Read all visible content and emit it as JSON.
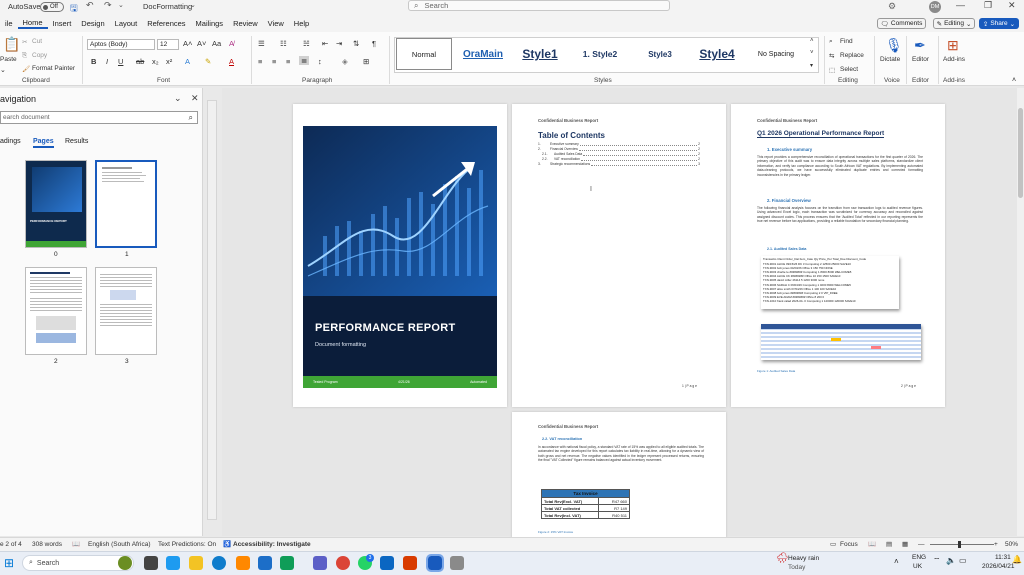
{
  "titlebar": {
    "autosave_label": "AutoSave",
    "autosave_state": "Off",
    "doc_name": "DocFormatting",
    "search_placeholder": "Search",
    "user_initials": "DM"
  },
  "menu": [
    "ile",
    "Home",
    "Insert",
    "Design",
    "Layout",
    "References",
    "Mailings",
    "Review",
    "View",
    "Help"
  ],
  "menu_active": "Home",
  "ribbon": {
    "comments": "Comments",
    "editing": "Editing",
    "share": "Share",
    "clipboard": {
      "paste": "Paste",
      "cut": "Cut",
      "copy": "Copy",
      "format_painter": "Format Painter",
      "group": "Clipboard"
    },
    "font": {
      "name": "Aptos (Body)",
      "size": "12",
      "group": "Font"
    },
    "paragraph_group": "Paragraph",
    "styles": [
      "Normal",
      "OraMain",
      "Style1",
      "1.  Style2",
      "Style3",
      "Style4",
      "No Spacing"
    ],
    "styles_group": "Styles",
    "editing_group": {
      "find": "Find",
      "replace": "Replace",
      "select": "Select",
      "label": "Editing"
    },
    "voice": {
      "dictate": "Dictate",
      "label": "Voice"
    },
    "editor": {
      "label": "Editor"
    },
    "addins": {
      "label": "Add-ins",
      "group": "Add-ins"
    }
  },
  "navpane": {
    "title": "avigation",
    "search_placeholder": "earch document",
    "tabs": [
      "adings",
      "Pages",
      "Results"
    ],
    "active_tab": "Pages",
    "thumb_labels": [
      "0",
      "1",
      "2",
      "3"
    ]
  },
  "cover": {
    "title": "PERFORMANCE REPORT",
    "subtitle": "Document formatting",
    "footer_left": "Tested Program",
    "footer_mid": "4/21/26",
    "footer_right": "Automated"
  },
  "toc_page": {
    "header": "Confidential Business Report",
    "title": "Table of Contents",
    "entries": [
      {
        "num": "1.",
        "text": "Executive summary",
        "page": "2"
      },
      {
        "num": "2.",
        "text": "Financial Overview",
        "page": "2"
      },
      {
        "num": "2.1.",
        "text": "Audited Sales Data",
        "page": "2"
      },
      {
        "num": "2.2.",
        "text": "VAT reconciliation",
        "page": "2"
      },
      {
        "num": "3.",
        "text": "Strategic recommendations",
        "page": "3"
      }
    ],
    "footer": "1 | P a g e"
  },
  "report_page": {
    "header": "Confidential Business Report",
    "title": "Q1 2026 Operational Performance Report",
    "h1": "1.  Executive summary",
    "p1": "This report provides a comprehensive reconciliation of operational transactions for the first quarter of 2026. The primary objective of this audit was to ensure data integrity across multiple sales platforms, standardize client information, and verify tax compliance according to South African VAT regulations. By implementing automated data-cleaning protocols, we have successfully eliminated duplicate entries and corrected formatting inconsistencies in the primary ledger.",
    "h2": "2.  Financial Overview",
    "p2": "The following financial analysis focuses on the transition from raw transaction logs to audited revenue figures. Using advanced Excel logic, each transaction was scrutinized for currency accuracy and reconciled against assigned discount codes. This process ensures that the 'Audited Total' reflected in our reporting represents the true net revenue before tax applications, providing a reliable foundation for secondary financial planning.",
    "h21": "2.1.  Audited Sales Data",
    "raw_header": "Transactio Client   Order_Dat Item_Cate Qty   Price_Per Total_Due Discount_Code",
    "raw_rows": [
      "TXN-9001 ALICE 09/15/26 DK 3 Computing   2   12500   25000 SAVE10",
      "TXN-9002 bob jones  04/03/26 Office       3     150     750 NONE",
      "TXN-9003 charlie Ie ######## Computing    1    8000    8000 WELCOME5",
      "TXN-9004 ALICE CK ######## Office        10     150    1500 SAVE10",
      "TXN-9005 david miller    46114            5    1200    3000 none",
      "TXN-9006 SARAH C  06/04/26 Computing      1    4000    8000 WELCOME5",
      "TXN-9007 alice smith  07/04/26 Office     1     100     100 SAVE10",
      "TXN-9008 bob jones ######## Computing     2             0 VIP_FREE",
      "TXN-9009 EVE ADAM ######## Office         8     200       0",
      "TXN-1010 frank calad 2026-04- 0 Computing  1  120000  120000 SAVE10"
    ],
    "figure_caption": "Figure 1: Audited Sales Data",
    "footer": "2 | P a g e"
  },
  "vat_page": {
    "header": "Confidential Business Report",
    "heading": "2.2.  VAT reconciliation",
    "para": "In accordance with national fiscal policy, a standard VAT rate of 15% was applied to all eligible audited totals. The automated tax engine developed for this report calculates tax liability in real-time, allowing for a dynamic view of both gross and net revenue. The negative values identified in the ledger represent processed returns, ensuring the final \"VAT Collected\" figure remains balanced against actual inventory movement.",
    "table_title": "Tax Invoice",
    "rows": [
      {
        "label": "Total Rev(Excl. VAT)",
        "value": "R47 660"
      },
      {
        "label": "Total VAT collected",
        "value": "R7 149"
      },
      {
        "label": "Total Rev(Incl. VAT)",
        "value": "R40 511"
      }
    ],
    "caption": "Figure 2: 15% VAT Invoice"
  },
  "statusbar": {
    "page": "e 2 of 4",
    "words": "308 words",
    "language": "English (South Africa)",
    "predictions": "Text Predictions: On",
    "accessibility": "Accessibility: Investigate",
    "focus": "Focus",
    "zoom": "50%"
  },
  "taskbar": {
    "search": "Search",
    "weather": "Heavy rain",
    "weather_sub": "Today",
    "lang": "ENG",
    "region": "UK",
    "time": "11:31",
    "date": "2026/04/21",
    "badge": "3"
  },
  "colors": {
    "accent": "#185abd",
    "cover_bg": "#0b1d3a",
    "cover_green": "#3fa535",
    "heading_blue": "#1f3864"
  }
}
